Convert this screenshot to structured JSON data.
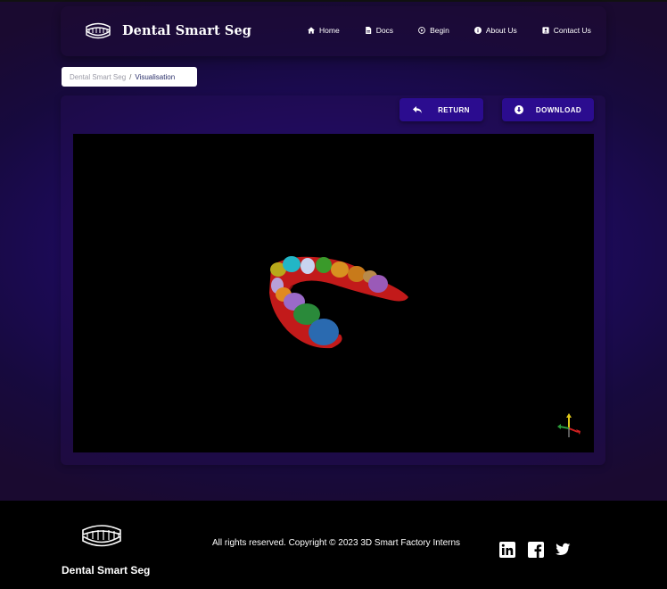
{
  "header": {
    "brand_name": "Dental Smart Seg",
    "nav": [
      {
        "label": "Home",
        "icon": "home-icon"
      },
      {
        "label": "Docs",
        "icon": "document-icon"
      },
      {
        "label": "Begin",
        "icon": "play-circle-icon"
      },
      {
        "label": "About Us",
        "icon": "info-icon"
      },
      {
        "label": "Contact Us",
        "icon": "contact-card-icon"
      }
    ]
  },
  "breadcrumb": {
    "parent": "Dental Smart Seg",
    "separator": "/",
    "current": "Visualisation"
  },
  "actions": {
    "return_label": "RETURN",
    "download_label": "DOWNLOAD"
  },
  "viewer": {
    "content": "3D segmented dental arch model",
    "axes_icon": "orientation-axes-icon"
  },
  "footer": {
    "brand_name": "Dental Smart Seg",
    "copyright": "All rights reserved. Copyright © 2023 3D Smart Factory Interns",
    "social": [
      "linkedin-icon",
      "facebook-icon",
      "twitter-icon"
    ]
  },
  "colors": {
    "accent": "#2b0c8f",
    "background_center": "#2a0a8a",
    "background_edge": "#1a0a30",
    "footer": "#000000"
  }
}
